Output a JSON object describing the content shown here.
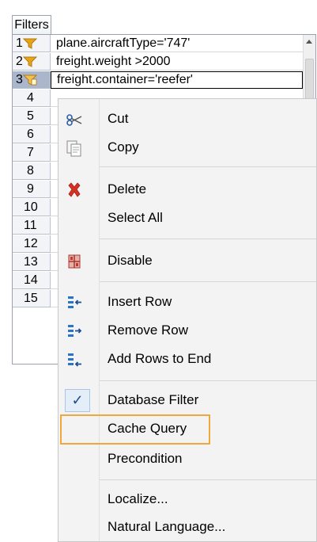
{
  "panel": {
    "tab_label": "Filters"
  },
  "rows": [
    {
      "num": "1",
      "filter": "plane.aircraftType='747'",
      "icon": "funnel-icon"
    },
    {
      "num": "2",
      "filter": "freight.weight >2000",
      "icon": "funnel-icon"
    },
    {
      "num": "3",
      "filter": "freight.container='reefer'",
      "icon": "funnel-cache-icon",
      "selected": true
    },
    {
      "num": "4",
      "filter": ""
    },
    {
      "num": "5",
      "filter": ""
    },
    {
      "num": "6",
      "filter": ""
    },
    {
      "num": "7",
      "filter": ""
    },
    {
      "num": "8",
      "filter": ""
    },
    {
      "num": "9",
      "filter": ""
    },
    {
      "num": "10",
      "filter": ""
    },
    {
      "num": "11",
      "filter": ""
    },
    {
      "num": "12",
      "filter": ""
    },
    {
      "num": "13",
      "filter": ""
    },
    {
      "num": "14",
      "filter": ""
    },
    {
      "num": "15",
      "filter": ""
    }
  ],
  "context_menu": {
    "cut": {
      "label": "Cut",
      "icon": "scissors-icon"
    },
    "copy": {
      "label": "Copy",
      "icon": "copy-icon"
    },
    "delete": {
      "label": "Delete",
      "icon": "delete-x-icon"
    },
    "select_all": {
      "label": "Select All"
    },
    "disable": {
      "label": "Disable",
      "icon": "disable-grid-icon"
    },
    "insert_row": {
      "label": "Insert Row",
      "icon": "insert-row-icon"
    },
    "remove_row": {
      "label": "Remove Row",
      "icon": "remove-row-icon"
    },
    "add_rows_end": {
      "label": "Add Rows to End",
      "icon": "add-rows-icon"
    },
    "database_filter": {
      "label": "Database Filter",
      "checked": true,
      "check_glyph": "✓"
    },
    "cache_query": {
      "label": "Cache Query",
      "highlight_color": "#f0a83c"
    },
    "precondition": {
      "label": "Precondition"
    },
    "localize": {
      "label": "Localize..."
    },
    "natural_language": {
      "label": "Natural Language..."
    }
  },
  "colors": {
    "selected_row_header": "#aab6cc",
    "funnel": "#e8a317",
    "delete": "#d93025",
    "row_icon": "#2b73c9",
    "disable": "#c0392b"
  }
}
